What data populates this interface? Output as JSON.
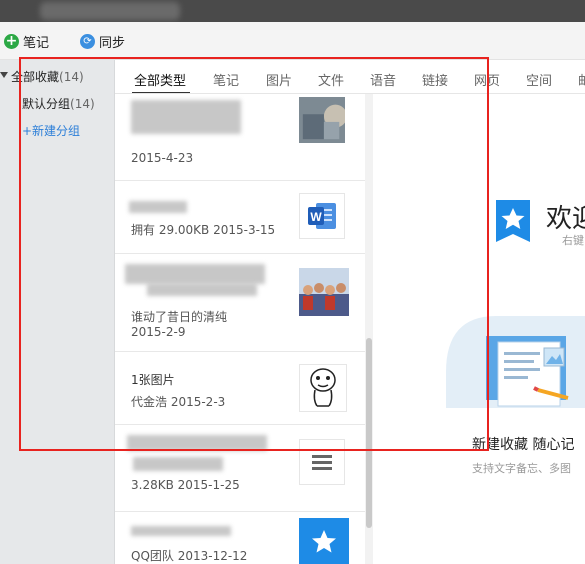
{
  "toolbar": {
    "new_note_label": "笔记",
    "sync_label": "同步"
  },
  "sidebar": {
    "all_favorites": {
      "label": "全部收藏",
      "count": "(14)"
    },
    "default_group": {
      "label": "默认分组",
      "count": "(14)"
    },
    "new_group_label": "+新建分组"
  },
  "tabs": [
    "全部类型",
    "笔记",
    "图片",
    "文件",
    "语音",
    "链接",
    "网页",
    "空间",
    "邮"
  ],
  "items": [
    {
      "title": "",
      "sub": "2015-4-23",
      "thumb": "photo"
    },
    {
      "title": "",
      "sub": "拥有 29.00KB 2015-3-15",
      "thumb": "word-doc"
    },
    {
      "title": "",
      "line2": "谁动了昔日的清纯",
      "sub": "2015-2-9",
      "thumb": "photo-group"
    },
    {
      "title": "1张图片",
      "sub": "代金浩 2015-2-3",
      "thumb": "sticker"
    },
    {
      "title": "",
      "sub": "3.28KB 2015-1-25",
      "thumb": "text-file"
    },
    {
      "title": "",
      "sub": "QQ团队 2013-12-12",
      "thumb": "favorite-star"
    }
  ],
  "welcome": {
    "title": "欢迎",
    "subtitle": "右键",
    "feature_title": "新建收藏 随心记",
    "feature_desc": "支持文字备忘、多图"
  },
  "colors": {
    "accent_blue": "#1e8be6",
    "annotation_red": "#e8231f",
    "sidebar_bg": "#e6e8ea"
  }
}
